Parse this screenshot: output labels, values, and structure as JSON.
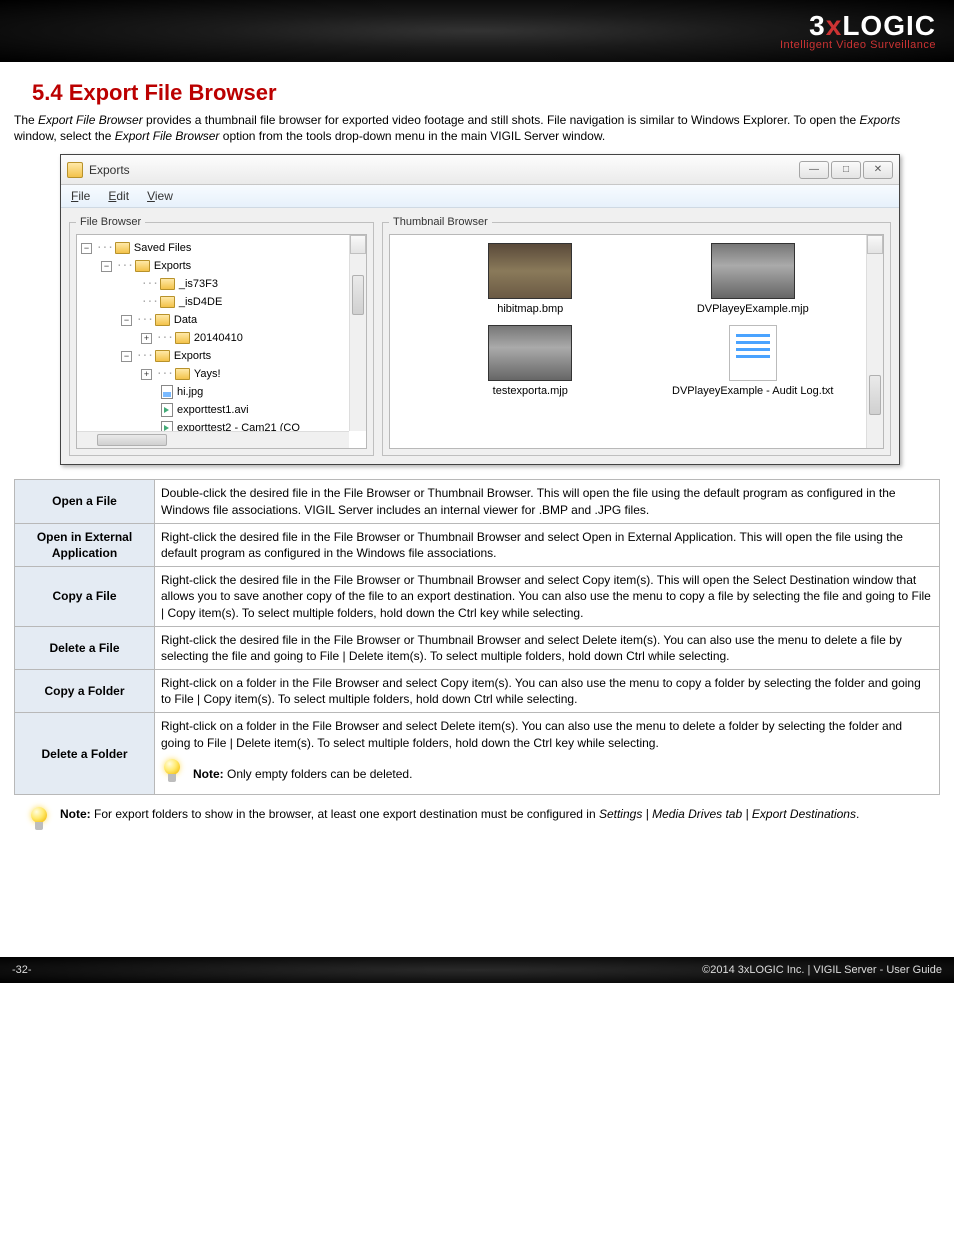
{
  "header": {
    "logo_main_pre": "3",
    "logo_main_x": "x",
    "logo_main_post": "LOGIC",
    "logo_sub": "Intelligent Video Surveillance"
  },
  "section": {
    "heading": "5.4 Export File Browser",
    "intro_1": "The ",
    "intro_em1": "Export File Browser",
    "intro_2": " provides a thumbnail file browser for exported video footage and still shots. File navigation is similar to Windows Explorer. To open the ",
    "intro_em2": "Exports",
    "intro_3": " window, select the ",
    "intro_em3": "Export File Browser",
    "intro_4": " option from the tools drop-down menu in the main VIGIL Server window."
  },
  "window": {
    "title": "Exports",
    "menu": {
      "file": "File",
      "edit": "Edit",
      "view": "View"
    },
    "file_browser_legend": "File Browser",
    "thumb_browser_legend": "Thumbnail Browser",
    "tree": {
      "n0": "Saved Files",
      "n1": "Exports",
      "n2": "_is73F3",
      "n3": "_isD4DE",
      "n4": "Data",
      "n5": "20140410",
      "n6": "Exports",
      "n7": "Yays!",
      "n8": "hi.jpg",
      "n9": "exporttest1.avi",
      "n10": "exporttest2 - Cam21 (CO"
    },
    "thumbs": {
      "t0": "hibitmap.bmp",
      "t1": "DVPlayeyExample.mjp",
      "t2": "testexporta.mjp",
      "t3": "DVPlayeyExample - Audit Log.txt"
    }
  },
  "table": {
    "r0": {
      "h": "Open a File",
      "d": "Double-click the desired file in the File Browser or Thumbnail Browser. This will open the file using the default program as configured in the Windows file associations.  VIGIL Server includes an internal viewer for .BMP and .JPG files."
    },
    "r1": {
      "h": "Open in External Application",
      "d": "Right-click the desired file in the File Browser or Thumbnail Browser and select Open in External Application.  This will open the file using the default program as configured in the Windows file associations."
    },
    "r2": {
      "h": "Copy a File",
      "d": "Right-click the desired file in the File Browser or Thumbnail Browser and select Copy item(s). This will open the Select Destination window that allows you to save another copy of the file to an export destination. You can also use the menu to copy a file by selecting the file and going to File | Copy item(s). To select multiple folders, hold down the Ctrl key while selecting."
    },
    "r3": {
      "h": "Delete a File",
      "d": "Right-click the desired file in the File Browser or Thumbnail Browser and select Delete item(s). You can also use the menu to delete a file by selecting the file and going to File | Delete item(s). To select multiple folders, hold down Ctrl while selecting."
    },
    "r4": {
      "h": "Copy a Folder",
      "d": "Right-click on a folder in the File Browser and select Copy item(s). You can also use the menu to copy a folder by selecting the folder and going to File | Copy item(s). To select multiple folders, hold down Ctrl while selecting."
    },
    "r5": {
      "h": "Delete a Folder",
      "d": "Right-click on a folder in the File Browser and select Delete item(s). You can also use the menu to delete a folder by selecting the folder and going to File | Delete item(s). To select multiple folders, hold down the Ctrl key while selecting.",
      "note_label": "Note:",
      "note_text": " Only empty folders can be deleted."
    }
  },
  "bottom_note": {
    "label": "Note:",
    "t1": " For export folders to show in the browser, at least one export destination must be configured in ",
    "em": "Settings | Media Drives tab | Export Destinations",
    "t2": "."
  },
  "footer": {
    "left": "-32-",
    "right": "©2014 3xLOGIC Inc. | VIGIL Server - User Guide"
  }
}
